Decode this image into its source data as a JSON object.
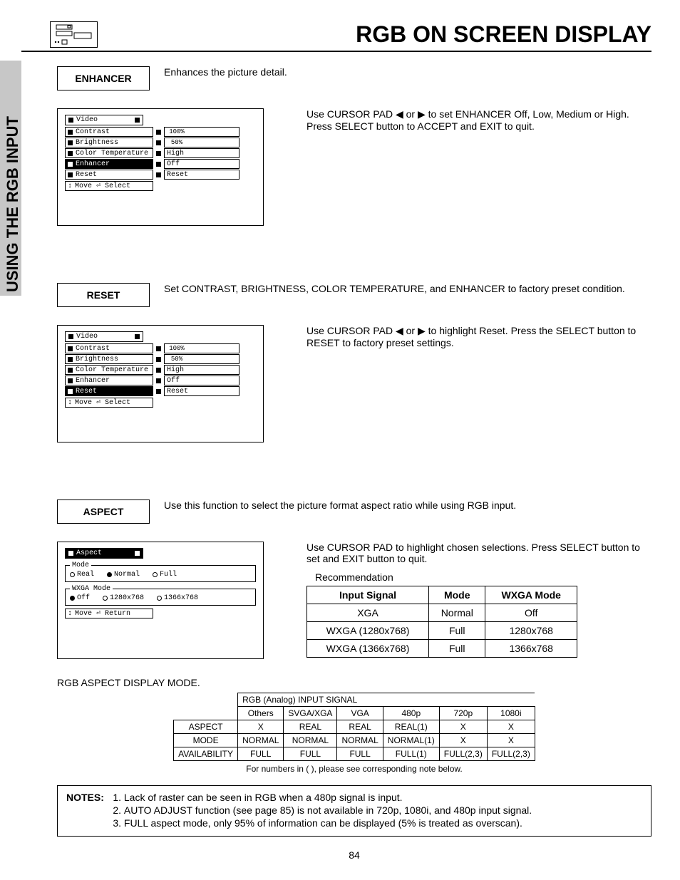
{
  "header": {
    "title": "RGB ON SCREEN DISPLAY"
  },
  "side_label": "USING THE RGB INPUT",
  "sections": {
    "enhancer": {
      "label": "ENHANCER",
      "desc": "Enhances the picture detail.",
      "instruction": "Use CURSOR PAD ◀ or ▶ to set ENHANCER Off, Low, Medium or High.  Press SELECT button to ACCEPT and EXIT to quit."
    },
    "reset": {
      "label": "RESET",
      "desc": "Set CONTRAST, BRIGHTNESS, COLOR TEMPERATURE, and ENHANCER to factory preset condition.",
      "instruction": "Use CURSOR PAD ◀ or ▶ to highlight Reset.  Press the SELECT button to RESET to factory preset settings."
    },
    "aspect": {
      "label": "ASPECT",
      "desc": "Use this function to select the picture format aspect ratio while using RGB input.",
      "instruction": "Use CURSOR PAD to highlight chosen selections.  Press SELECT button to set and EXIT button to quit."
    }
  },
  "osd_video": {
    "title": "Video",
    "items": [
      {
        "label": "Contrast",
        "value": "100%",
        "progress": 100
      },
      {
        "label": "Brightness",
        "value": "50%",
        "progress": 50
      },
      {
        "label": "Color Temperature",
        "value": "High"
      },
      {
        "label": "Enhancer",
        "value": "Off"
      },
      {
        "label": "Reset",
        "value": "Reset"
      }
    ],
    "footer": "Move ⏎ Select",
    "highlight_enhancer_index": 3,
    "highlight_reset_index": 4
  },
  "osd_aspect": {
    "title": "Aspect",
    "mode_legend": "Mode",
    "modes": [
      {
        "label": "Real",
        "checked": false
      },
      {
        "label": "Normal",
        "checked": true
      },
      {
        "label": "Full",
        "checked": false
      }
    ],
    "wxga_legend": "WXGA Mode",
    "wxga_modes": [
      {
        "label": "Off",
        "checked": true
      },
      {
        "label": "1280x768",
        "checked": false
      },
      {
        "label": "1366x768",
        "checked": false
      }
    ],
    "footer": "Move ⏎ Return"
  },
  "recommendation": {
    "heading": "Recommendation",
    "headers": [
      "Input Signal",
      "Mode",
      "WXGA Mode"
    ],
    "rows": [
      [
        "XGA",
        "Normal",
        "Off"
      ],
      [
        "WXGA (1280x768)",
        "Full",
        "1280x768"
      ],
      [
        "WXGA (1366x768)",
        "Full",
        "1366x768"
      ]
    ]
  },
  "aspect_display": {
    "heading": "RGB ASPECT DISPLAY MODE.",
    "signal_title": "RGB (Analog) INPUT SIGNAL",
    "row_labels": [
      "ASPECT",
      "MODE",
      "AVAILABILITY"
    ],
    "cols": [
      "Others",
      "SVGA/XGA",
      "VGA",
      "480p",
      "720p",
      "1080i"
    ],
    "rows": [
      [
        "X",
        "REAL",
        "REAL",
        "REAL(1)",
        "X",
        "X"
      ],
      [
        "NORMAL",
        "NORMAL",
        "NORMAL",
        "NORMAL(1)",
        "X",
        "X"
      ],
      [
        "FULL",
        "FULL",
        "FULL",
        "FULL(1)",
        "FULL(2,3)",
        "FULL(2,3)"
      ]
    ],
    "note": "For numbers in ( ), please see corresponding note below."
  },
  "notes": {
    "label": "NOTES:",
    "items": [
      "Lack of raster can be seen in RGB when a 480p signal is input.",
      "AUTO ADJUST function (see page 85) is not available in 720p, 1080i, and 480p input signal.",
      "FULL aspect mode, only 95% of information can be displayed (5% is treated as overscan)."
    ]
  },
  "page_number": "84"
}
